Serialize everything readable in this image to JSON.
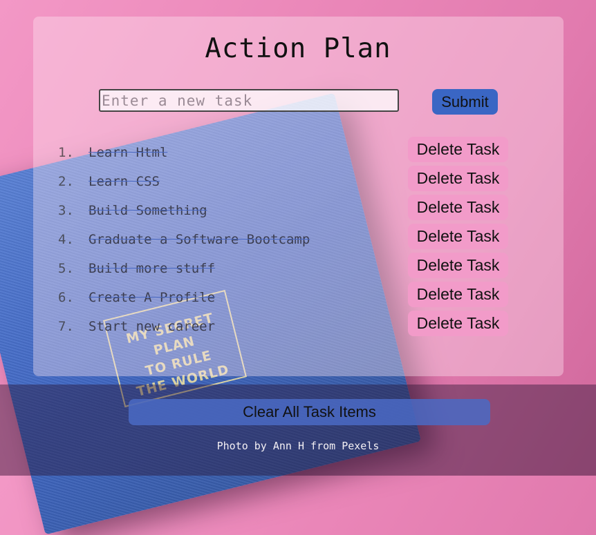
{
  "header": {
    "title": "Action Plan"
  },
  "form": {
    "input_placeholder": "Enter a new task",
    "input_value": "",
    "submit_label": "Submit"
  },
  "tasks": [
    {
      "number": "1.",
      "text": "Learn Html",
      "completed": true,
      "delete_label": "Delete Task"
    },
    {
      "number": "2.",
      "text": "Learn CSS",
      "completed": true,
      "delete_label": "Delete Task"
    },
    {
      "number": "3.",
      "text": "Build Something",
      "completed": true,
      "delete_label": "Delete Task"
    },
    {
      "number": "4.",
      "text": "Graduate a Software Bootcamp",
      "completed": true,
      "delete_label": "Delete Task"
    },
    {
      "number": "5.",
      "text": "Build more stuff",
      "completed": true,
      "delete_label": "Delete Task"
    },
    {
      "number": "6.",
      "text": "Create A Profile",
      "completed": true,
      "delete_label": "Delete Task"
    },
    {
      "number": "7.",
      "text": "Start new career",
      "completed": false,
      "delete_label": "Delete Task"
    }
  ],
  "footer": {
    "clear_label": "Clear All Task Items",
    "credit": "Photo by Ann H from Pexels"
  },
  "background_photo": {
    "stamp_lines": [
      "MY SECRET",
      "PLAN",
      "TO RULE",
      "THE WORLD"
    ]
  },
  "colors": {
    "accent_blue": "#3a66c4",
    "delete_pink": "#f29bc9",
    "background_pink": "#ea86b8"
  }
}
